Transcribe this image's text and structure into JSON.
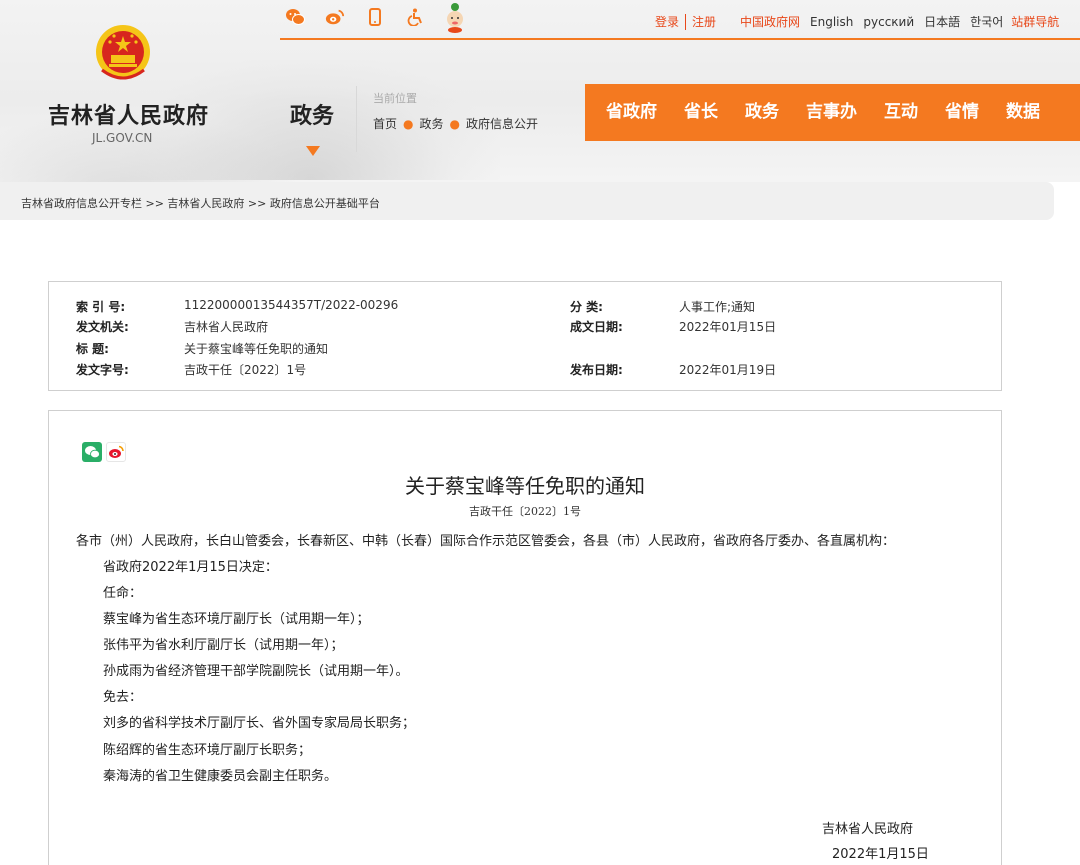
{
  "header": {
    "top_icons": [
      "wechat-icon",
      "weibo-icon",
      "mobile-icon",
      "accessibility-icon",
      "mascot-icon"
    ],
    "login": "登录",
    "register": "注册",
    "china_gov": "中国政府网",
    "languages": [
      "English",
      "русский",
      "日本語",
      "한국어"
    ],
    "site_nav": "站群导航",
    "site_title": "吉林省人民政府",
    "site_url": "JL.GOV.CN",
    "section": "政务",
    "current_position_label": "当前位置",
    "crumbs": [
      "首页",
      "政务",
      "政府信息公开"
    ],
    "main_nav": [
      "省政府",
      "省长",
      "政务",
      "吉事办",
      "互动",
      "省情",
      "数据"
    ],
    "accent_color": "#f47920"
  },
  "path": "吉林省政府信息公开专栏 >> 吉林省人民政府 >> 政府信息公开基础平台",
  "info": {
    "index_label": "索 引 号:",
    "index_value": "11220000013544357T/2022-00296",
    "category_label": "分    类:",
    "category_value": "人事工作;通知",
    "issuer_label": "发文机关:",
    "issuer_value": "吉林省人民政府",
    "created_label": "成文日期:",
    "created_value": "2022年01月15日",
    "title_label": "标    题:",
    "title_value": "关于蔡宝峰等任免职的通知",
    "doc_no_label": "发文字号:",
    "doc_no_value": "吉政干任〔2022〕1号",
    "published_label": "发布日期:",
    "published_value": "2022年01月19日"
  },
  "document": {
    "title": "关于蔡宝峰等任免职的通知",
    "number": "吉政干任〔2022〕1号",
    "addressee": "各市（州）人民政府，长白山管委会，长春新区、中韩（长春）国际合作示范区管委会，各县（市）人民政府，省政府各厅委办、各直属机构：",
    "lines": [
      "省政府2022年1月15日决定：",
      "任命：",
      "蔡宝峰为省生态环境厅副厅长（试用期一年）；",
      "张伟平为省水利厅副厅长（试用期一年）；",
      "孙成雨为省经济管理干部学院副院长（试用期一年）。",
      "免去：",
      "刘多的省科学技术厅副厅长、省外国专家局局长职务；",
      "陈绍辉的省生态环境厅副厅长职务；",
      "秦海涛的省卫生健康委员会副主任职务。"
    ],
    "signature": "吉林省人民政府",
    "sign_date": "2022年1月15日"
  }
}
